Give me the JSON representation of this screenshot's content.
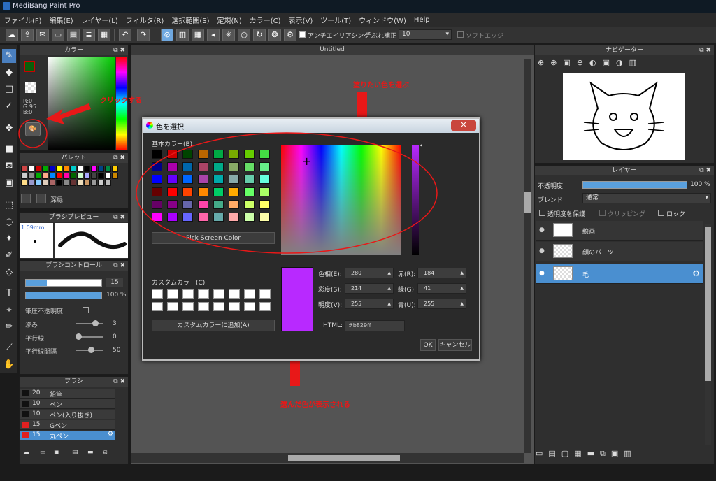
{
  "app": {
    "title": "MediBang Paint Pro"
  },
  "menu": [
    "ファイル(F)",
    "編集(E)",
    "レイヤー(L)",
    "フィルタ(R)",
    "選択範囲(S)",
    "定規(N)",
    "カラー(C)",
    "表示(V)",
    "ツール(T)",
    "ウィンドウ(W)",
    "Help"
  ],
  "toolbar": {
    "antialias": "アンチエイリアシング",
    "stabilizer_label": "手ぶれ補正",
    "stabilizer_value": "10",
    "soft_edge": "ソフトエッジ"
  },
  "canvas": {
    "tab": "Untitled"
  },
  "color_panel": {
    "title": "カラー",
    "rgb": [
      "R:0",
      "G:95",
      "B:0"
    ]
  },
  "palette_panel": {
    "title": "パレット",
    "selected_name": "深緑"
  },
  "brush_preview": {
    "title": "ブラシプレビュー",
    "size": "1.09mm"
  },
  "brush_control": {
    "title": "ブラシコントロール",
    "size_value": "15",
    "opacity_value": "100 %",
    "pen_opacity": "筆圧不透明度",
    "blur": "滲み",
    "blur_value": "3",
    "parallel": "平行線",
    "parallel_value": "0",
    "parallel_gap": "平行線間隔",
    "parallel_gap_value": "50"
  },
  "brush_panel": {
    "title": "ブラシ",
    "items": [
      {
        "size": "20",
        "name": "鉛筆",
        "color": "#222"
      },
      {
        "size": "10",
        "name": "ペン",
        "color": "#222"
      },
      {
        "size": "10",
        "name": "ペン(入り抜き)",
        "color": "#222"
      },
      {
        "size": "15",
        "name": "Gペン",
        "color": "#e02020"
      },
      {
        "size": "15",
        "name": "丸ペン",
        "color": "#e02020"
      }
    ]
  },
  "navigator": {
    "title": "ナビゲーター"
  },
  "layers": {
    "title": "レイヤー",
    "opacity_label": "不透明度",
    "opacity_value": "100 %",
    "blend_label": "ブレンド",
    "blend_value": "通常",
    "protect": "透明度を保護",
    "clipping": "クリッピング",
    "lock": "ロック",
    "items": [
      {
        "name": "線画",
        "selected": false
      },
      {
        "name": "顔のパーツ",
        "selected": false
      },
      {
        "name": "毛",
        "selected": true
      }
    ]
  },
  "dialog": {
    "title": "色を選択",
    "basic_colors": "基本カラー(B)",
    "pick_screen": "Pick Screen Color",
    "custom_colors": "カスタムカラー(C)",
    "add_custom": "カスタムカラーに追加(A)",
    "hue_label": "色相(E):",
    "hue": "280",
    "sat_label": "彩度(S):",
    "sat": "214",
    "val_label": "明度(V):",
    "val": "255",
    "red_label": "赤(R):",
    "red": "184",
    "green_label": "緑(G):",
    "green": "41",
    "blue_label": "青(U):",
    "blue": "255",
    "html_label": "HTML:",
    "html": "#b829ff",
    "ok": "OK",
    "cancel": "キャンセル",
    "selected_color": "#b829ff"
  },
  "annotations": {
    "click": "クリックする",
    "pick": "塗りたい色を選ぶ",
    "shown": "選んだ色が表示される"
  }
}
